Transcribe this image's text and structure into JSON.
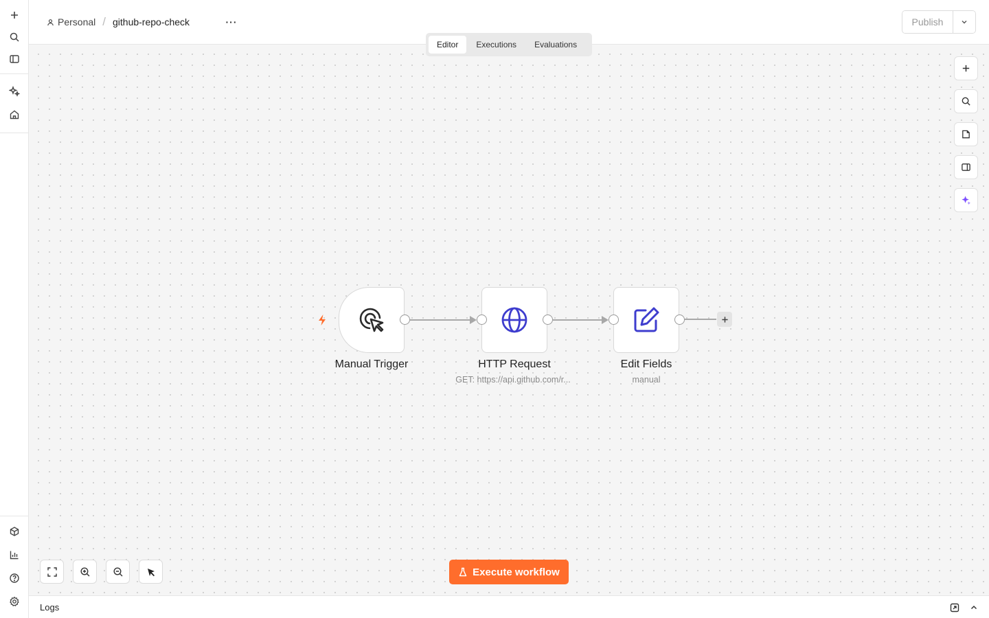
{
  "header": {
    "project": "Personal",
    "separator": "/",
    "workflow_name": "github-repo-check",
    "more_label": "···",
    "publish_label": "Publish"
  },
  "tabs": [
    {
      "label": "Editor",
      "active": true
    },
    {
      "label": "Executions",
      "active": false
    },
    {
      "label": "Evaluations",
      "active": false
    }
  ],
  "sidebar": {
    "top_icons": [
      "plus-icon",
      "search-icon",
      "panel-icon"
    ],
    "middle_icons": [
      "sparkle-icon",
      "home-icon"
    ],
    "bottom_icons": [
      "cube-icon",
      "chart-icon",
      "help-icon",
      "settings-icon"
    ]
  },
  "right_tools": [
    "plus-icon",
    "search-icon",
    "sticky-note-icon",
    "panel-right-icon",
    "ai-sparkle-icon"
  ],
  "nodes": [
    {
      "name": "Manual Trigger",
      "subtitle": "",
      "icon": "cursor-click-icon",
      "color": "#2b2b2b"
    },
    {
      "name": "HTTP Request",
      "subtitle": "GET: https://api.github.com/r...",
      "icon": "globe-icon",
      "color": "#3e3dce"
    },
    {
      "name": "Edit Fields",
      "subtitle": "manual",
      "icon": "edit-icon",
      "color": "#3e3dce"
    }
  ],
  "canvas_controls": [
    "fit-view-icon",
    "zoom-in-icon",
    "zoom-out-icon",
    "pointer-icon"
  ],
  "execute_button": {
    "label": "Execute workflow",
    "color": "#ff6d2c"
  },
  "logs": {
    "title": "Logs"
  },
  "colors": {
    "accent": "#ff6d2c",
    "node_icon": "#3e3dce",
    "ai": "#7c4dff"
  }
}
